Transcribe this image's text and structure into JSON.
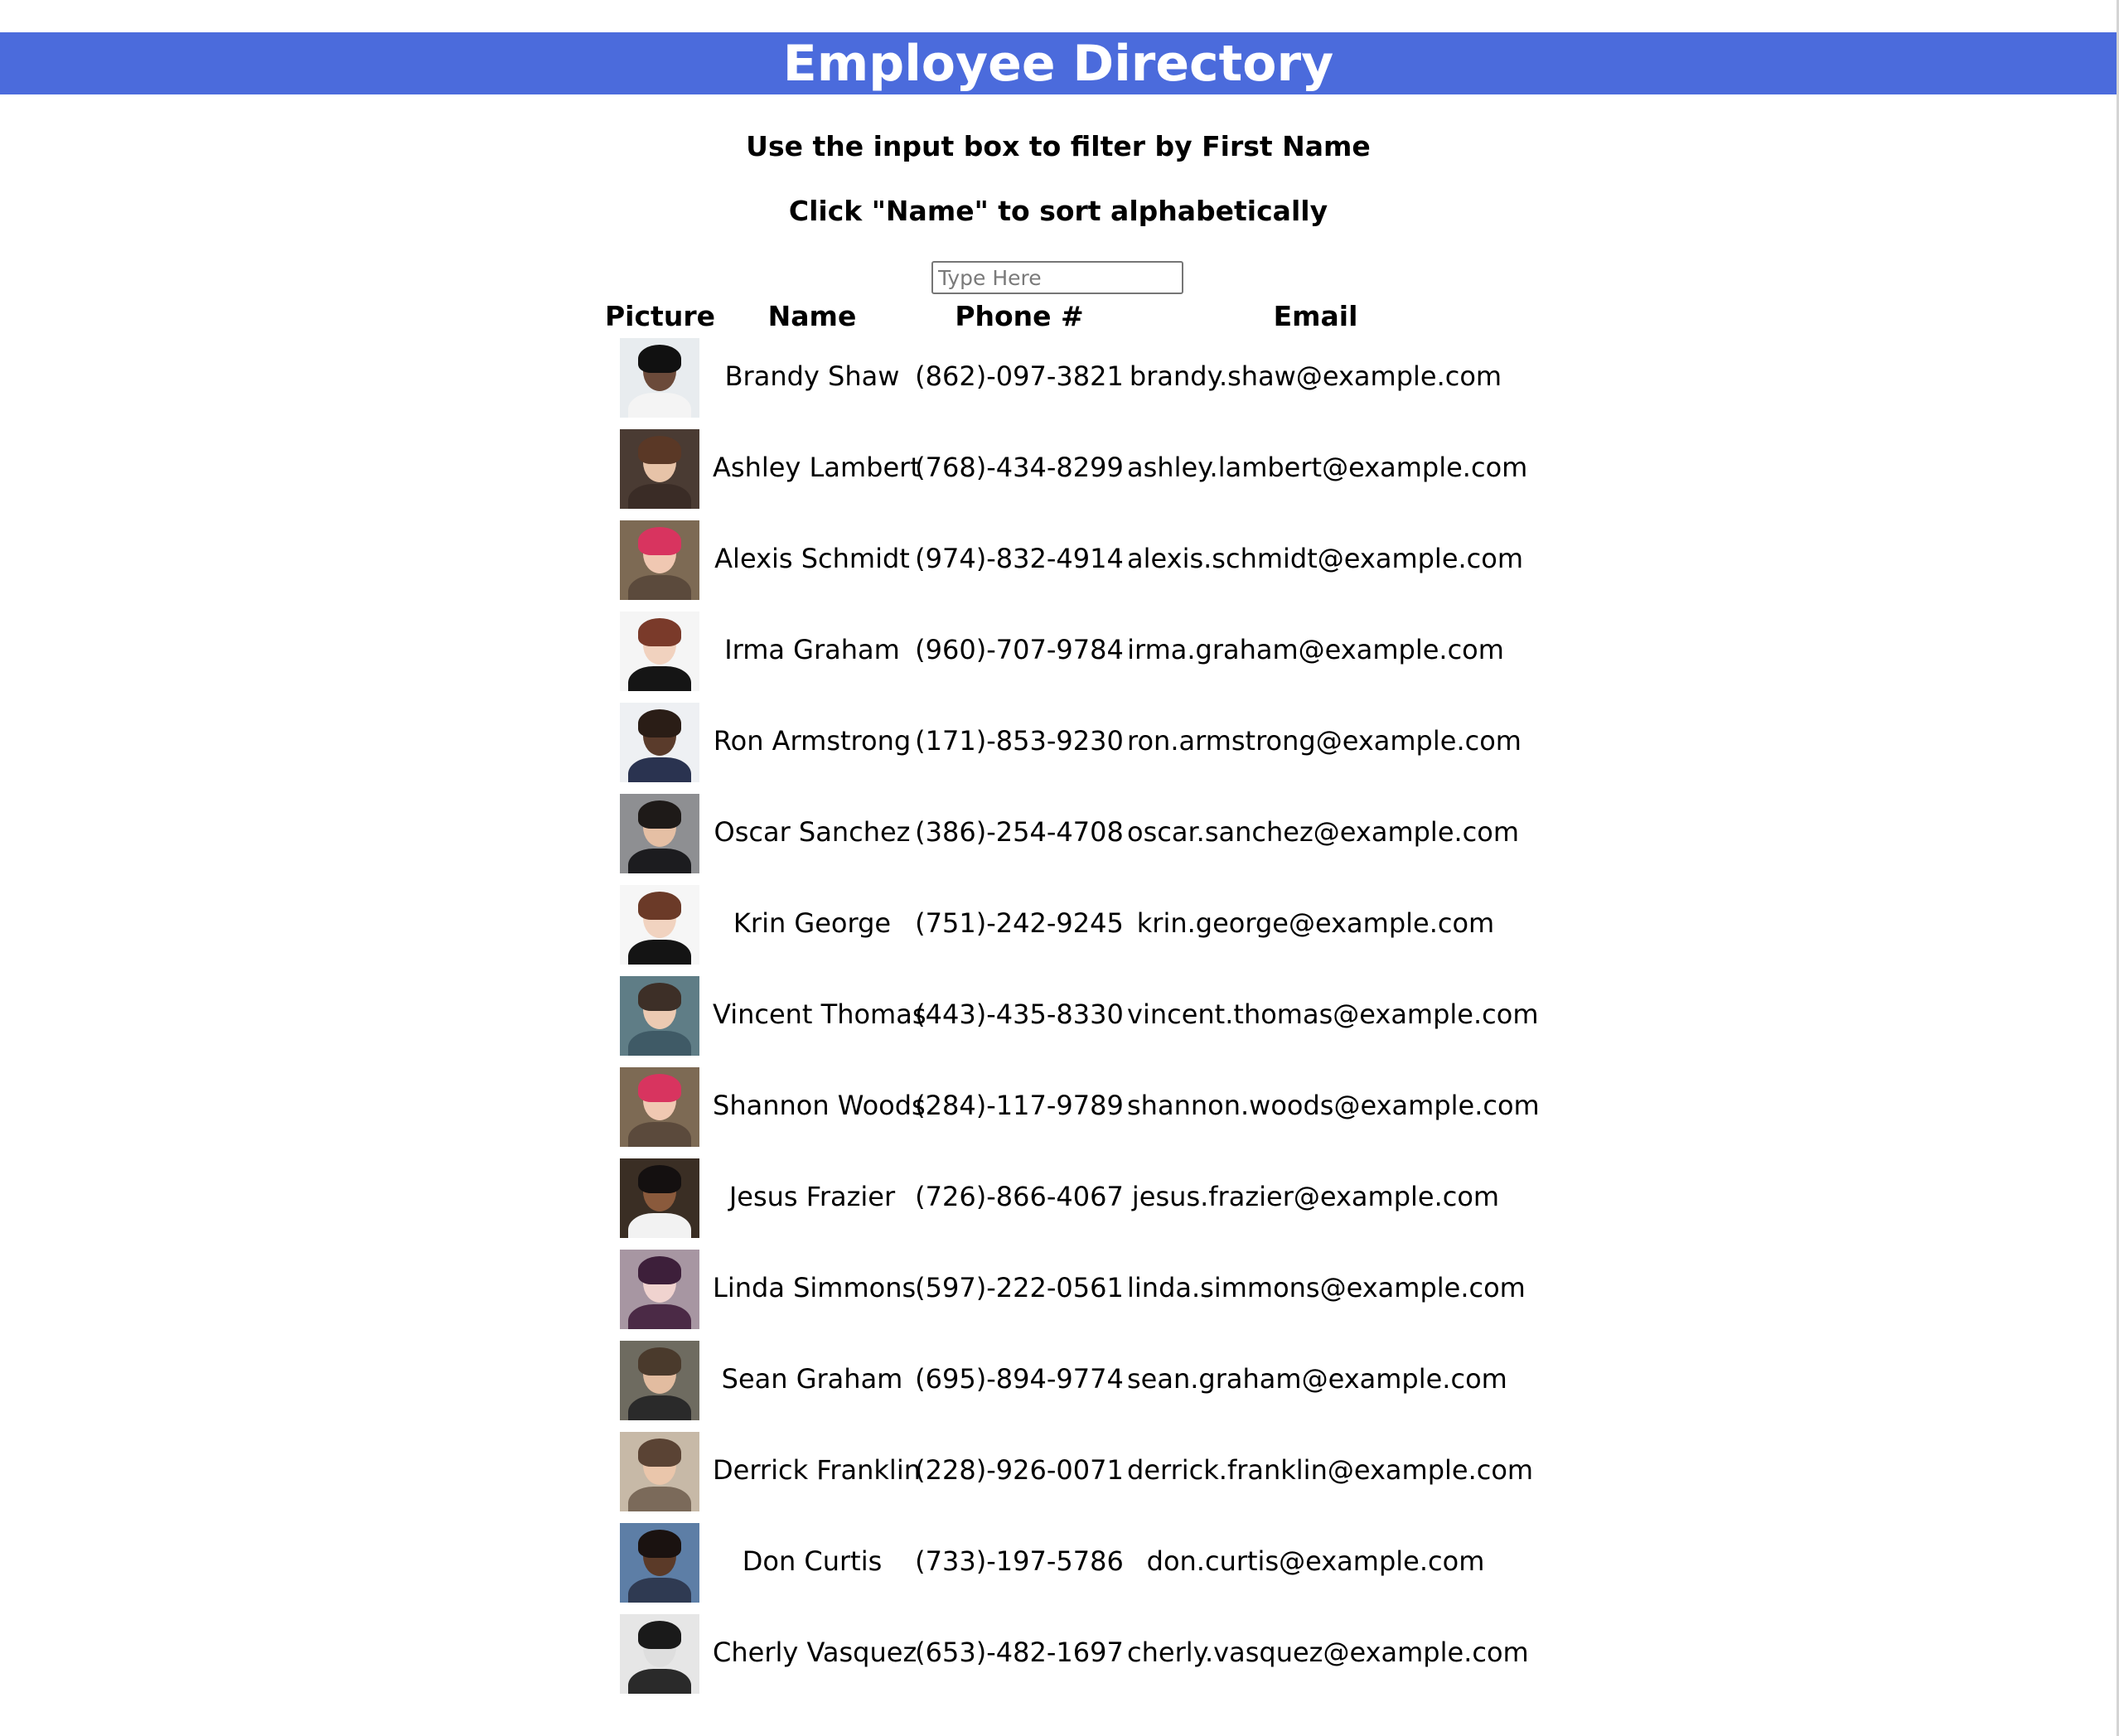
{
  "header": {
    "title": "Employee Directory"
  },
  "instructions": [
    "Use the input box to filter by First Name",
    "Click \"Name\" to sort alphabetically"
  ],
  "filter": {
    "placeholder": "Type Here",
    "value": ""
  },
  "table": {
    "headers": {
      "picture": "Picture",
      "name": "Name",
      "phone": "Phone #",
      "email": "Email"
    },
    "rows": [
      {
        "name": "Brandy Shaw",
        "phone": "(862)-097-3821",
        "email": "brandy.shaw@example.com",
        "avatar": {
          "bg": "#e8ecef",
          "skin": "#6b4a3a",
          "hair": "#111111",
          "shirt": "#f4f4f4"
        }
      },
      {
        "name": "Ashley Lambert",
        "phone": "(768)-434-8299",
        "email": "ashley.lambert@example.com",
        "avatar": {
          "bg": "#4a3b33",
          "skin": "#e7c3a8",
          "hair": "#5a3826",
          "shirt": "#3a2c26"
        }
      },
      {
        "name": "Alexis Schmidt",
        "phone": "(974)-832-4914",
        "email": "alexis.schmidt@example.com",
        "avatar": {
          "bg": "#7d6a54",
          "skin": "#f0c8b2",
          "hair": "#d8345f",
          "shirt": "#5b4a3c"
        }
      },
      {
        "name": "Irma Graham",
        "phone": "(960)-707-9784",
        "email": "irma.graham@example.com",
        "avatar": {
          "bg": "#f5f5f5",
          "skin": "#f1d2bf",
          "hair": "#7a3a2a",
          "shirt": "#151515"
        }
      },
      {
        "name": "Ron Armstrong",
        "phone": "(171)-853-9230",
        "email": "ron.armstrong@example.com",
        "avatar": {
          "bg": "#eef0f3",
          "skin": "#5a3b2b",
          "hair": "#2a1d16",
          "shirt": "#2a3350"
        }
      },
      {
        "name": "Oscar Sanchez",
        "phone": "(386)-254-4708",
        "email": "oscar.sanchez@example.com",
        "avatar": {
          "bg": "#8e8f92",
          "skin": "#e5bfa4",
          "hair": "#1e1a18",
          "shirt": "#1c1c1f"
        }
      },
      {
        "name": "Krin George",
        "phone": "(751)-242-9245",
        "email": "krin.george@example.com",
        "avatar": {
          "bg": "#f6f6f6",
          "skin": "#f1d3c0",
          "hair": "#6b3a28",
          "shirt": "#141414"
        }
      },
      {
        "name": "Vincent Thomas",
        "phone": "(443)-435-8330",
        "email": "vincent.thomas@example.com",
        "avatar": {
          "bg": "#5f7d86",
          "skin": "#eccab2",
          "hair": "#3d2f27",
          "shirt": "#3f5a66"
        }
      },
      {
        "name": "Shannon Woods",
        "phone": "(284)-117-9789",
        "email": "shannon.woods@example.com",
        "avatar": {
          "bg": "#7d6a54",
          "skin": "#f0c8b2",
          "hair": "#d8345f",
          "shirt": "#5b4a3c"
        }
      },
      {
        "name": "Jesus Frazier",
        "phone": "(726)-866-4067",
        "email": "jesus.frazier@example.com",
        "avatar": {
          "bg": "#3a2e24",
          "skin": "#8a5a3c",
          "hair": "#141010",
          "shirt": "#f2f2f2"
        }
      },
      {
        "name": "Linda Simmons",
        "phone": "(597)-222-0561",
        "email": "linda.simmons@example.com",
        "avatar": {
          "bg": "#a796a2",
          "skin": "#f0d3cf",
          "hair": "#3d1f3a",
          "shirt": "#4b2a46"
        }
      },
      {
        "name": "Sean Graham",
        "phone": "(695)-894-9774",
        "email": "sean.graham@example.com",
        "avatar": {
          "bg": "#6e6b60",
          "skin": "#e2bca0",
          "hair": "#4a3a2c",
          "shirt": "#2a2a2a"
        }
      },
      {
        "name": "Derrick Franklin",
        "phone": "(228)-926-0071",
        "email": "derrick.franklin@example.com",
        "avatar": {
          "bg": "#c7b9a7",
          "skin": "#eac6ab",
          "hair": "#5a4334",
          "shirt": "#7b6a5a"
        }
      },
      {
        "name": "Don Curtis",
        "phone": "(733)-197-5786",
        "email": "don.curtis@example.com",
        "avatar": {
          "bg": "#5d7ea6",
          "skin": "#5b3a28",
          "hair": "#1a1210",
          "shirt": "#2f3a52"
        }
      },
      {
        "name": "Cherly Vasquez",
        "phone": "(653)-482-1697",
        "email": "cherly.vasquez@example.com",
        "avatar": {
          "bg": "#e6e6e6",
          "skin": "#dedede",
          "hair": "#1a1a1a",
          "shirt": "#2a2a2a"
        }
      }
    ]
  }
}
